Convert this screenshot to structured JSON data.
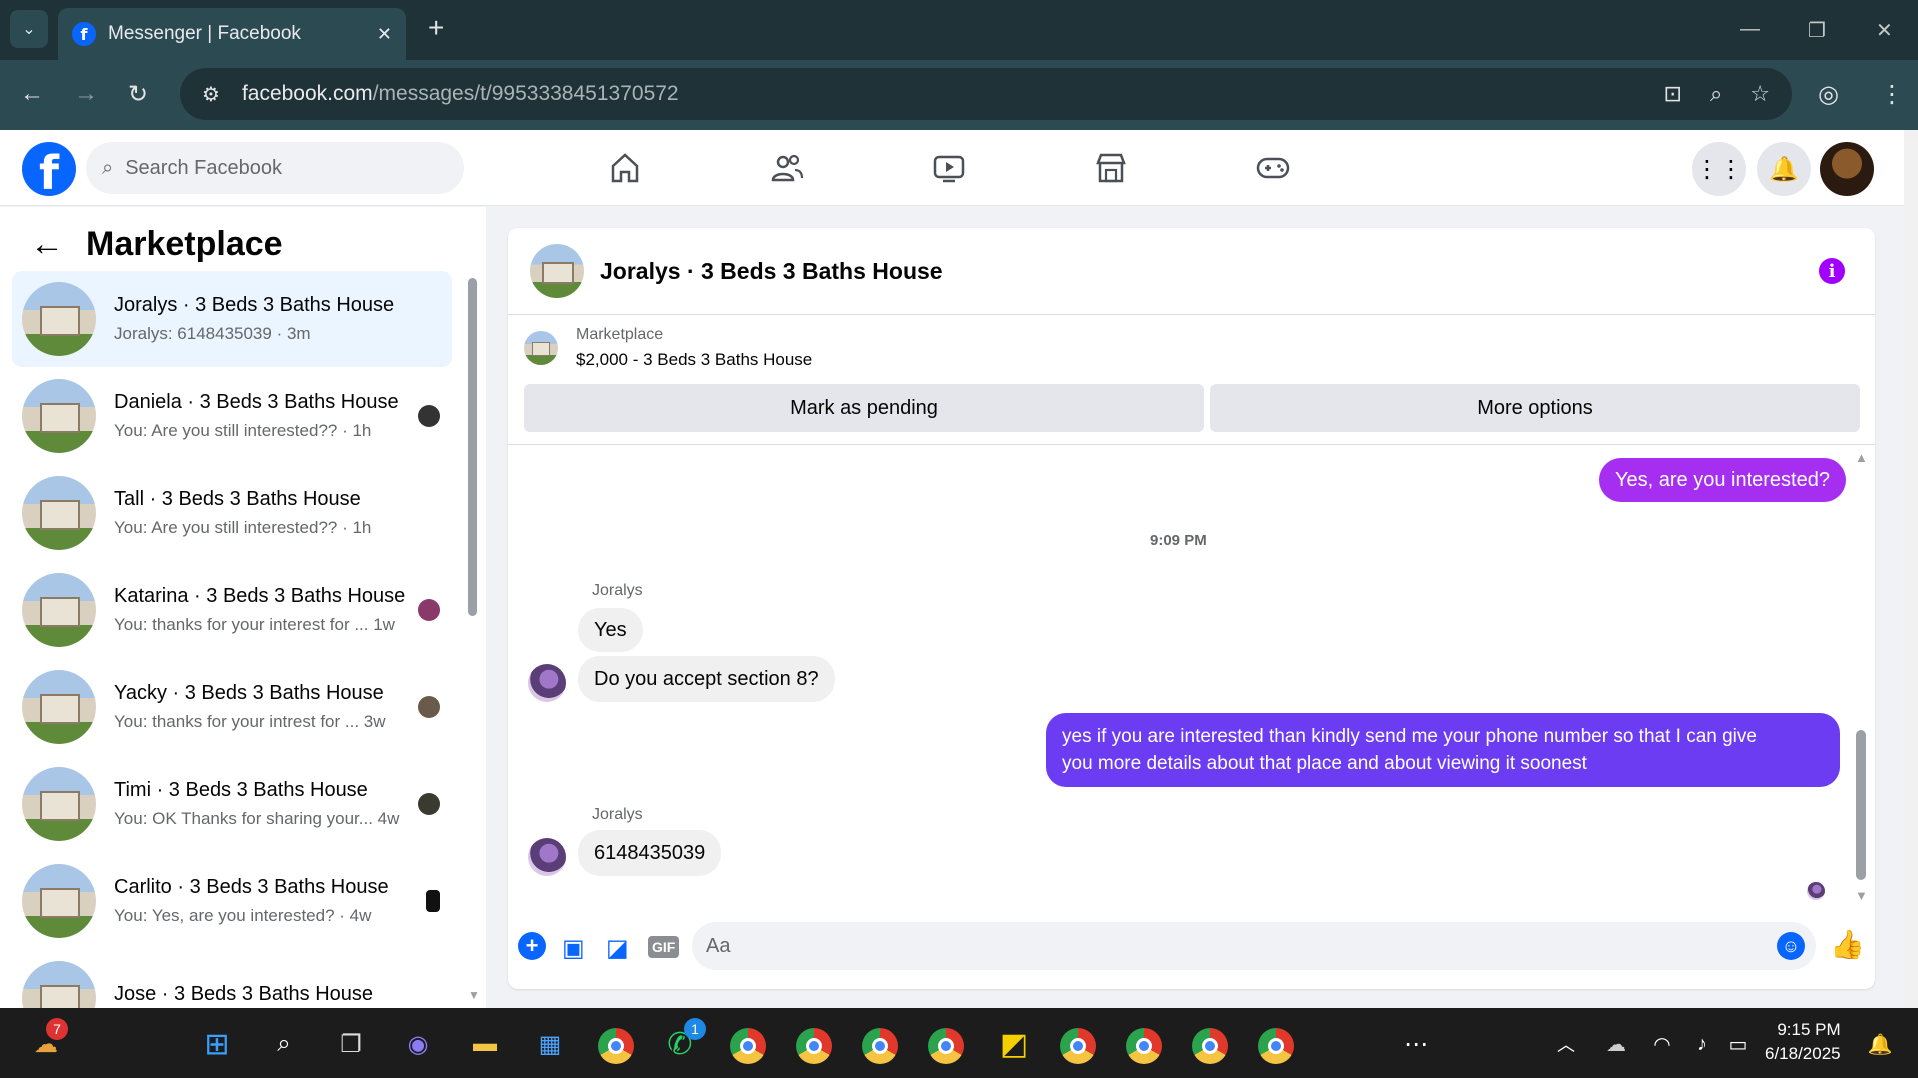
{
  "browser": {
    "tab_title": "Messenger | Facebook",
    "url_domain": "facebook.com",
    "url_path": "/messages/t/9953338451370572"
  },
  "facebook": {
    "search_placeholder": "Search Facebook"
  },
  "sidebar": {
    "title": "Marketplace",
    "conversations": [
      {
        "name": "Joralys · 3 Beds 3 Baths House",
        "preview": "Joralys: 6148435039 · 3m",
        "active": true
      },
      {
        "name": "Daniela · 3 Beds 3 Baths House",
        "preview": "You: Are you still interested?? · 1h"
      },
      {
        "name": "Tall · 3 Beds 3 Baths House",
        "preview": "You: Are you still interested?? · 1h"
      },
      {
        "name": "Katarina · 3 Beds 3 Baths House",
        "preview": "You: thanks for your interest for ...  1w"
      },
      {
        "name": "Yacky · 3 Beds 3 Baths House",
        "preview": "You: thanks for your intrest for ...  3w"
      },
      {
        "name": "Timi · 3 Beds 3 Baths House",
        "preview": "You: OK Thanks for sharing your... 4w"
      },
      {
        "name": "Carlito · 3 Beds 3 Baths House",
        "preview": "You: Yes, are you interested? · 4w"
      },
      {
        "name": "Jose · 3 Beds 3 Baths House",
        "preview": ""
      }
    ]
  },
  "chat": {
    "title": "Joralys · 3 Beds 3 Baths House",
    "marketplace_label": "Marketplace",
    "listing": "$2,000 - 3 Beds 3 Baths House",
    "mark_pending": "Mark as pending",
    "more_options": "More options",
    "messages": {
      "m1": "Yes, are you interested?",
      "time": "9:09 PM",
      "sender1": "Joralys",
      "m2": "Yes",
      "m3": "Do you accept section 8?",
      "m4_line1": "yes if you are interested than kindly send me your phone number so that I can give",
      "m4_line2": "you more details about that place and about viewing it soonest",
      "sender2": "Joralys",
      "m5": "6148435039"
    },
    "composer_placeholder": "Aa"
  },
  "taskbar": {
    "time": "9:15 PM",
    "date": "6/18/2025",
    "weather_badge": "7",
    "whatsapp_badge": "1"
  }
}
